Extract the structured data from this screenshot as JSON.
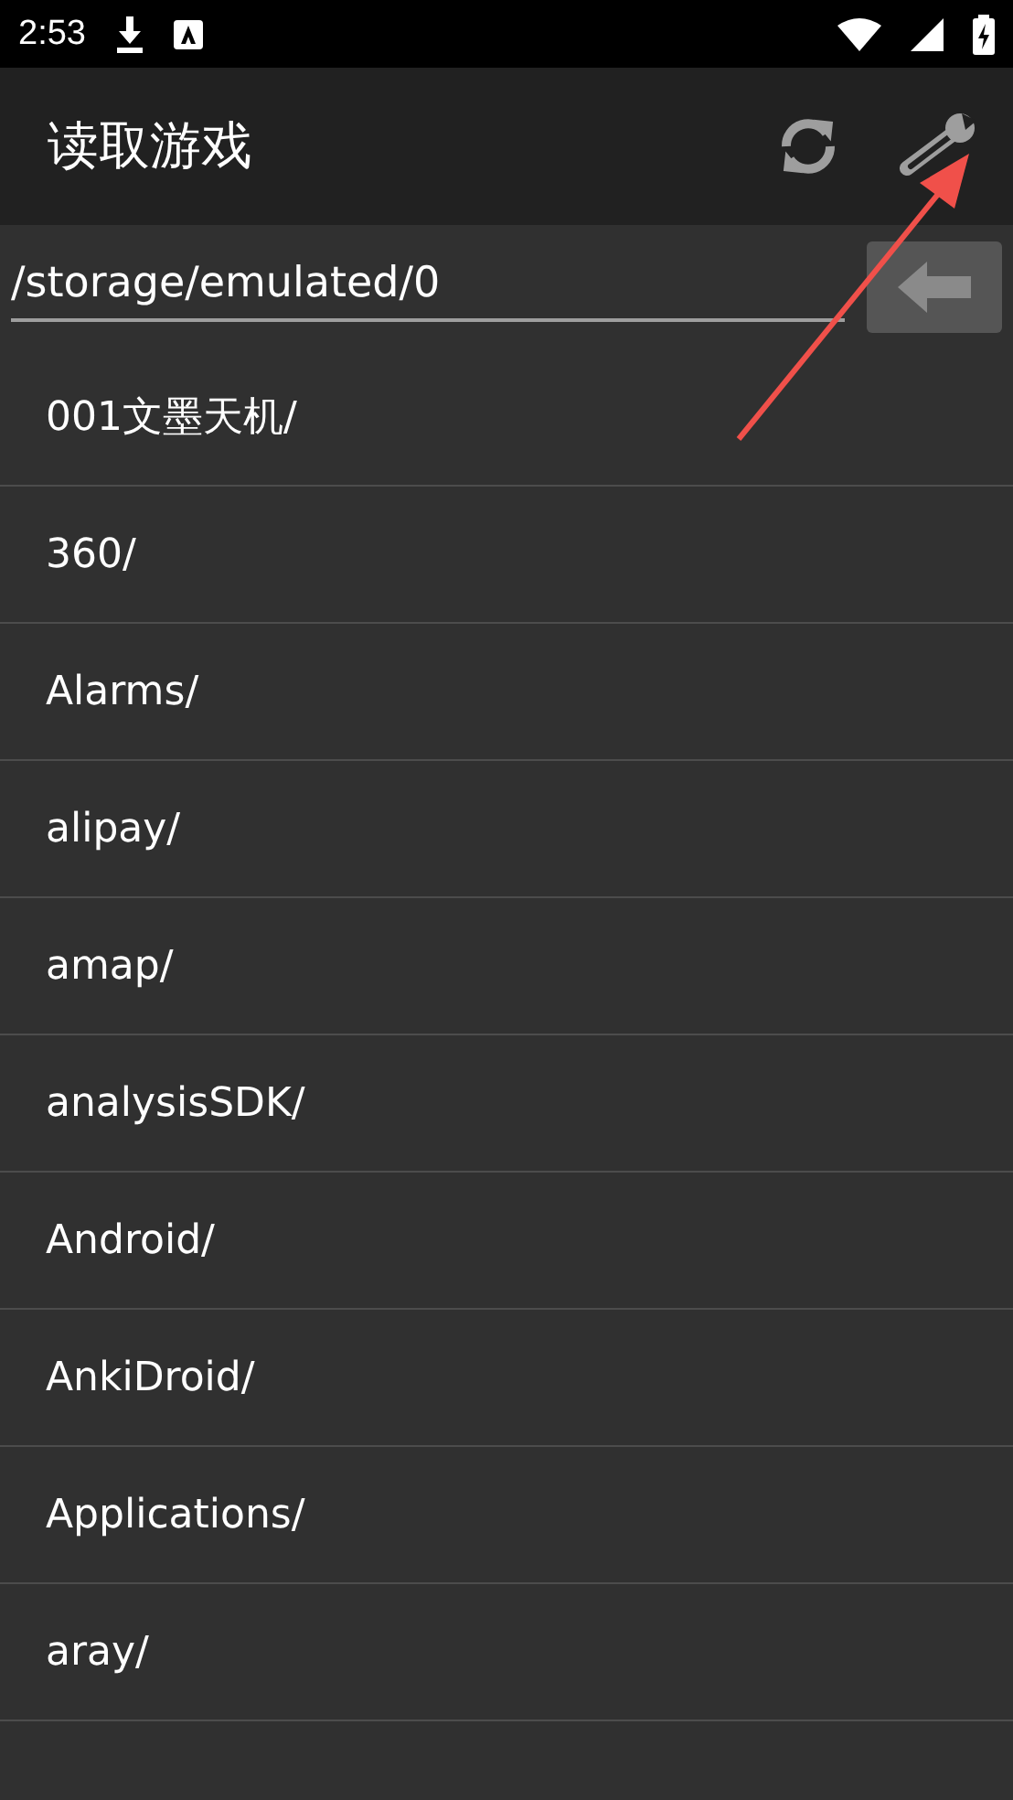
{
  "status_bar": {
    "time": "2:53"
  },
  "toolbar": {
    "title": "读取游戏"
  },
  "path_field": {
    "value": "/storage/emulated/0"
  },
  "files": [
    {
      "name": "001文墨天机/"
    },
    {
      "name": "360/"
    },
    {
      "name": "Alarms/"
    },
    {
      "name": "alipay/"
    },
    {
      "name": "amap/"
    },
    {
      "name": "analysisSDK/"
    },
    {
      "name": "Android/"
    },
    {
      "name": "AnkiDroid/"
    },
    {
      "name": "Applications/"
    },
    {
      "name": "aray/"
    }
  ]
}
